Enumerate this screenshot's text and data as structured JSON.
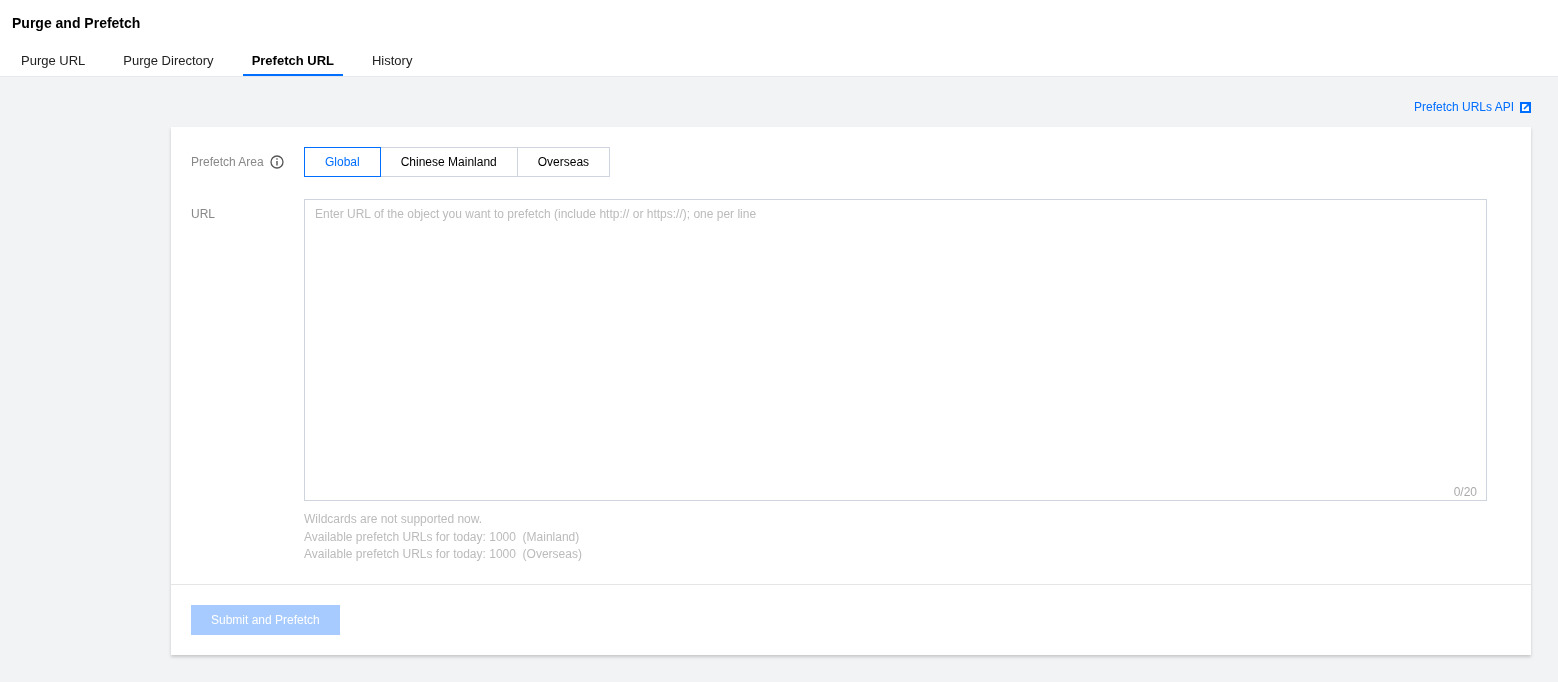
{
  "page_title": "Purge and Prefetch",
  "tabs": [
    {
      "label": "Purge URL",
      "selected": false
    },
    {
      "label": "Purge Directory",
      "selected": false
    },
    {
      "label": "Prefetch URL",
      "selected": true
    },
    {
      "label": "History",
      "selected": false
    }
  ],
  "api_link": "Prefetch URLs API",
  "form": {
    "area_label": "Prefetch Area",
    "areas": [
      {
        "label": "Global",
        "selected": true
      },
      {
        "label": "Chinese Mainland",
        "selected": false
      },
      {
        "label": "Overseas",
        "selected": false
      }
    ],
    "url_label": "URL",
    "url_placeholder": "Enter URL of the object you want to prefetch (include http:// or https://); one per line",
    "counter": "0/20",
    "hints": [
      "Wildcards are not supported now.",
      "Available prefetch URLs for today: 1000  (Mainland)",
      "Available prefetch URLs for today: 1000  (Overseas)"
    ]
  },
  "submit": {
    "label": "Submit and Prefetch",
    "disabled": true
  }
}
